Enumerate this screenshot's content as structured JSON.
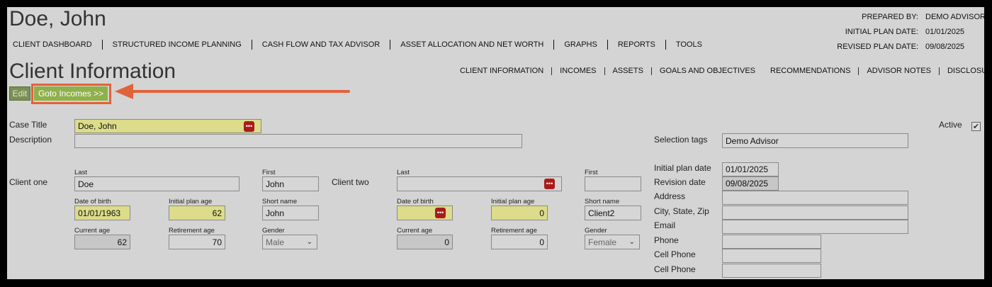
{
  "header": {
    "client_name": "Doe, John",
    "prepared_by_label": "PREPARED BY:",
    "prepared_by_value": "DEMO ADVISOR",
    "initial_plan_date_label": "INITIAL PLAN DATE:",
    "initial_plan_date_value": "01/01/2025",
    "revised_plan_date_label": "REVISED PLAN DATE:",
    "revised_plan_date_value": "09/08/2025"
  },
  "top_nav": [
    "CLIENT DASHBOARD",
    "STRUCTURED INCOME PLANNING",
    "CASH FLOW AND TAX ADVISOR",
    "ASSET ALLOCATION AND NET WORTH",
    "GRAPHS",
    "REPORTS",
    "TOOLS"
  ],
  "section_title": "Client Information",
  "sub_nav_left": [
    "CLIENT INFORMATION",
    "INCOMES",
    "ASSETS",
    "GOALS AND OBJECTIVES"
  ],
  "sub_nav_right": [
    "RECOMMENDATIONS",
    "ADVISOR NOTES",
    "DISCLOSURE"
  ],
  "buttons": {
    "edit": "Edit",
    "goto_incomes": "Goto Incomes >>"
  },
  "form": {
    "case_title_label": "Case Title",
    "case_title_value": "Doe, John",
    "description_label": "Description",
    "description_value": "",
    "active_label": "Active",
    "active_mark": "✔",
    "dots_glyph": "•••",
    "selection_tags_label": "Selection tags",
    "selection_tags_value": "Demo Advisor",
    "client_one": {
      "label": "Client one",
      "last_label": "Last",
      "last_value": "Doe",
      "first_label": "First",
      "first_value": "John",
      "dob_label": "Date of birth",
      "dob_value": "01/01/1963",
      "initial_plan_age_label": "Initial plan age",
      "initial_plan_age_value": "62",
      "short_name_label": "Short name",
      "short_name_value": "John",
      "current_age_label": "Current age",
      "current_age_value": "62",
      "retirement_age_label": "Retirement age",
      "retirement_age_value": "70",
      "gender_label": "Gender",
      "gender_value": "Male"
    },
    "client_two": {
      "label": "Client two",
      "last_label": "Last",
      "last_value": "",
      "first_label": "First",
      "first_value": "",
      "dob_label": "Date of birth",
      "dob_value": "",
      "initial_plan_age_label": "Initial plan age",
      "initial_plan_age_value": "0",
      "short_name_label": "Short name",
      "short_name_value": "Client2",
      "current_age_label": "Current age",
      "current_age_value": "0",
      "retirement_age_label": "Retirement age",
      "retirement_age_value": "0",
      "gender_label": "Gender",
      "gender_value": "Female"
    },
    "right_panel": {
      "initial_plan_date_label": "Initial plan date",
      "initial_plan_date_value": "01/01/2025",
      "revision_date_label": "Revision date",
      "revision_date_value": "09/08/2025",
      "address_label": "Address",
      "address_value": "",
      "city_state_zip_label": "City, State, Zip",
      "city_state_zip_value": "",
      "email_label": "Email",
      "email_value": "",
      "phone_label": "Phone",
      "phone_value": "",
      "cell_phone_label": "Cell Phone",
      "cell_phone_value": "",
      "cell_phone2_label": "Cell Phone",
      "cell_phone2_value": ""
    }
  },
  "colors": {
    "accent_green": "#8fb04b",
    "highlight_orange": "#e2623a",
    "field_yellow": "#dcdc8a",
    "dots_red": "#a91b1b"
  }
}
